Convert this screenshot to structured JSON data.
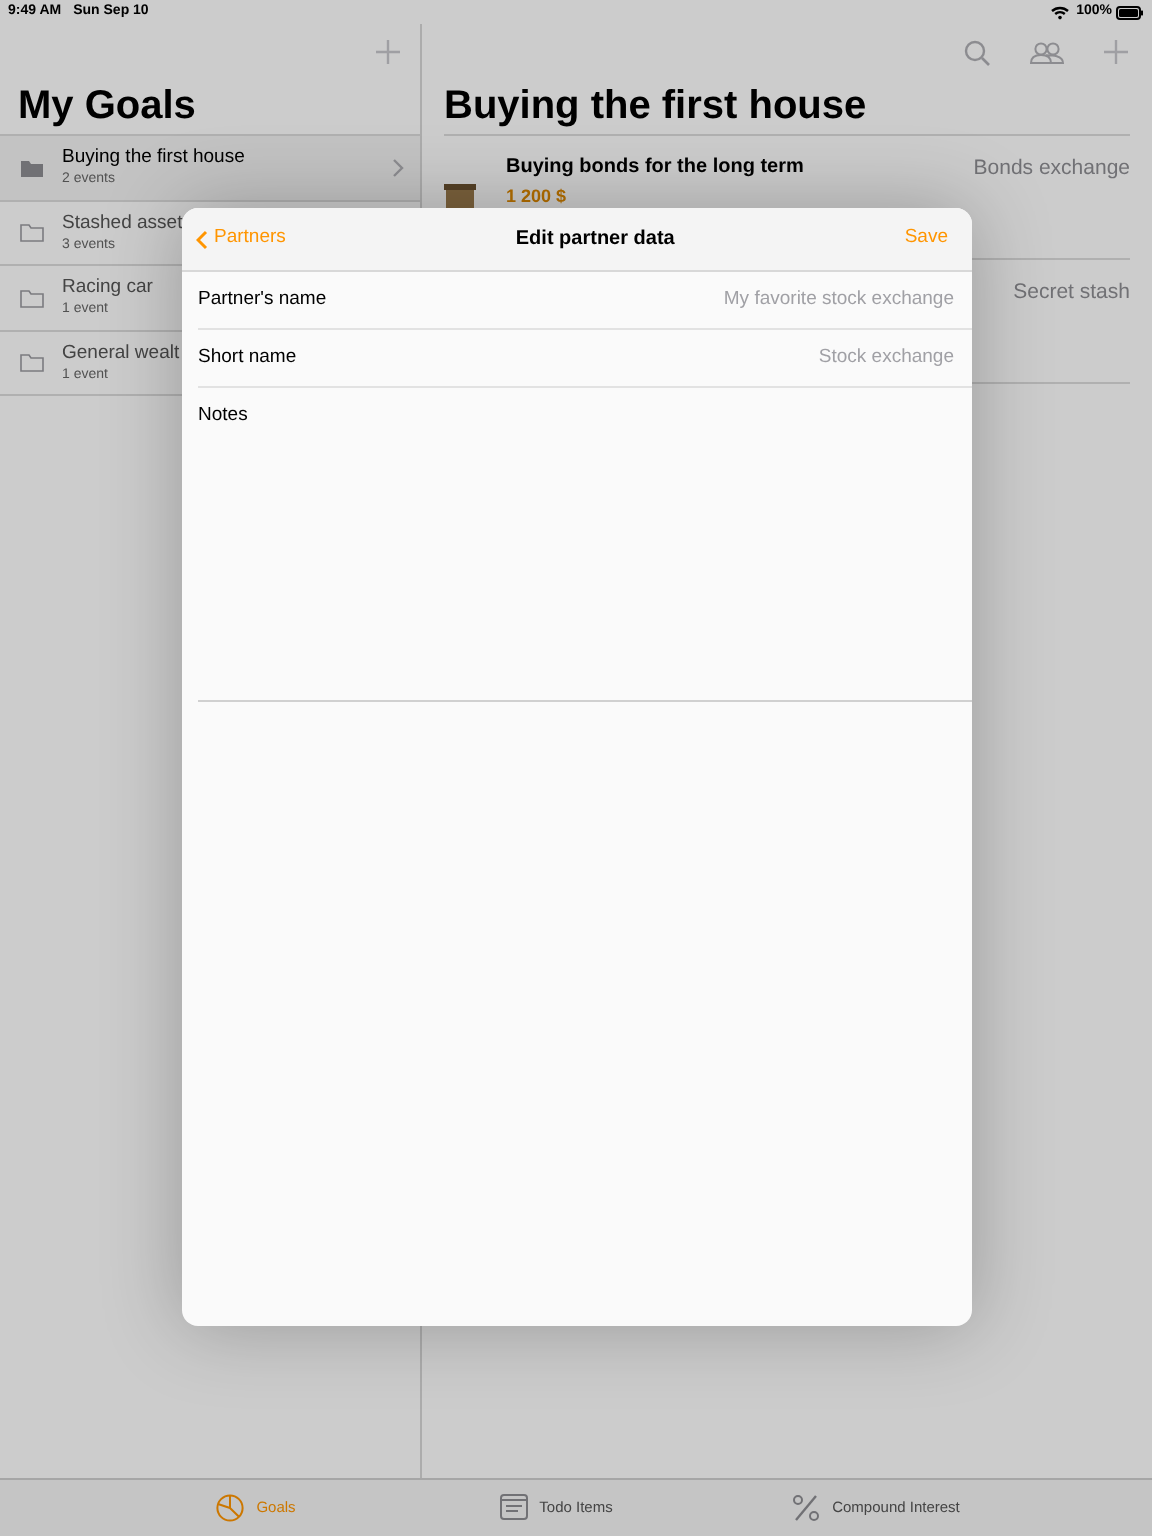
{
  "status_bar": {
    "time": "9:49 AM",
    "date": "Sun Sep 10",
    "battery": "100%"
  },
  "sidebar": {
    "title": "My Goals",
    "items": [
      {
        "title": "Buying the first house",
        "subtitle": "2 events",
        "selected": true
      },
      {
        "title": "Stashed asset",
        "subtitle": "3 events",
        "selected": false
      },
      {
        "title": "Racing car",
        "subtitle": "1 event",
        "selected": false
      },
      {
        "title": "General wealt",
        "subtitle": "1 event",
        "selected": false
      }
    ]
  },
  "detail": {
    "title": "Buying the first house",
    "events": [
      {
        "title": "Buying bonds for the long term",
        "amount": "1 200 $",
        "partner": "Bonds exchange"
      },
      {
        "partner": "Secret stash"
      }
    ]
  },
  "tab_bar": [
    {
      "label": "Goals",
      "kind": "chart",
      "selected": true
    },
    {
      "label": "Todo Items",
      "kind": "list",
      "selected": false
    },
    {
      "label": "Compound Interest",
      "kind": "percent",
      "selected": false
    }
  ],
  "modal": {
    "back": "Partners",
    "title": "Edit partner data",
    "save": "Save",
    "fields": [
      {
        "label": "Partner's name",
        "placeholder": "My favorite stock exchange"
      },
      {
        "label": "Short name",
        "placeholder": "Stock exchange"
      }
    ],
    "notes_label": "Notes"
  }
}
